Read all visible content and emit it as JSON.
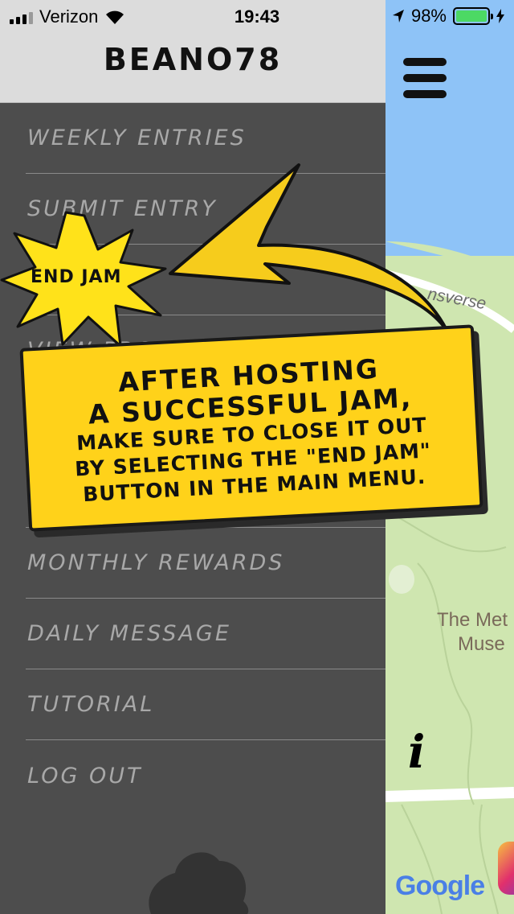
{
  "status_bar": {
    "carrier": "Verizon",
    "time": "19:43",
    "battery": "98%",
    "signal_icon": "cellular-signal-icon",
    "wifi_icon": "wifi-icon",
    "location_icon": "location-arrow-icon",
    "charging_icon": "charging-bolt-icon"
  },
  "drawer": {
    "username": "BEANO78",
    "menu_items": [
      {
        "label": "Weekly Entries"
      },
      {
        "label": "Submit Entry"
      },
      {
        "label": "End Jam"
      },
      {
        "label": "View Profile"
      },
      {
        "label": ""
      },
      {
        "label": ""
      },
      {
        "label": "Monthly Rewards"
      },
      {
        "label": "Daily Message"
      },
      {
        "label": "Tutorial"
      },
      {
        "label": "Log Out"
      }
    ]
  },
  "map": {
    "road_label": "nsverse",
    "poi_label_line1": "The Met",
    "poi_label_line2": "Muse",
    "attribution": "Google",
    "menu_icon": "hamburger-menu-icon",
    "info_icon": "info-icon",
    "info_glyph": "i"
  },
  "tutorial": {
    "starburst_label": "END JAM",
    "line1": "AFTER HOSTING",
    "line2": "A SUCCESSFUL JAM,",
    "line3": "MAKE SURE TO CLOSE IT OUT",
    "line4": "BY SELECTING THE \"END JAM\"",
    "line5": "BUTTON IN THE MAIN MENU."
  },
  "colors": {
    "drawer_bg": "#4d4d4d",
    "header_bg": "#dcdcdc",
    "menu_text": "#a8a8a8",
    "callout_bg": "#ffd21a",
    "map_park": "#cfe6b0",
    "map_water": "#8ec3f7",
    "battery_fill": "#4cd964"
  }
}
